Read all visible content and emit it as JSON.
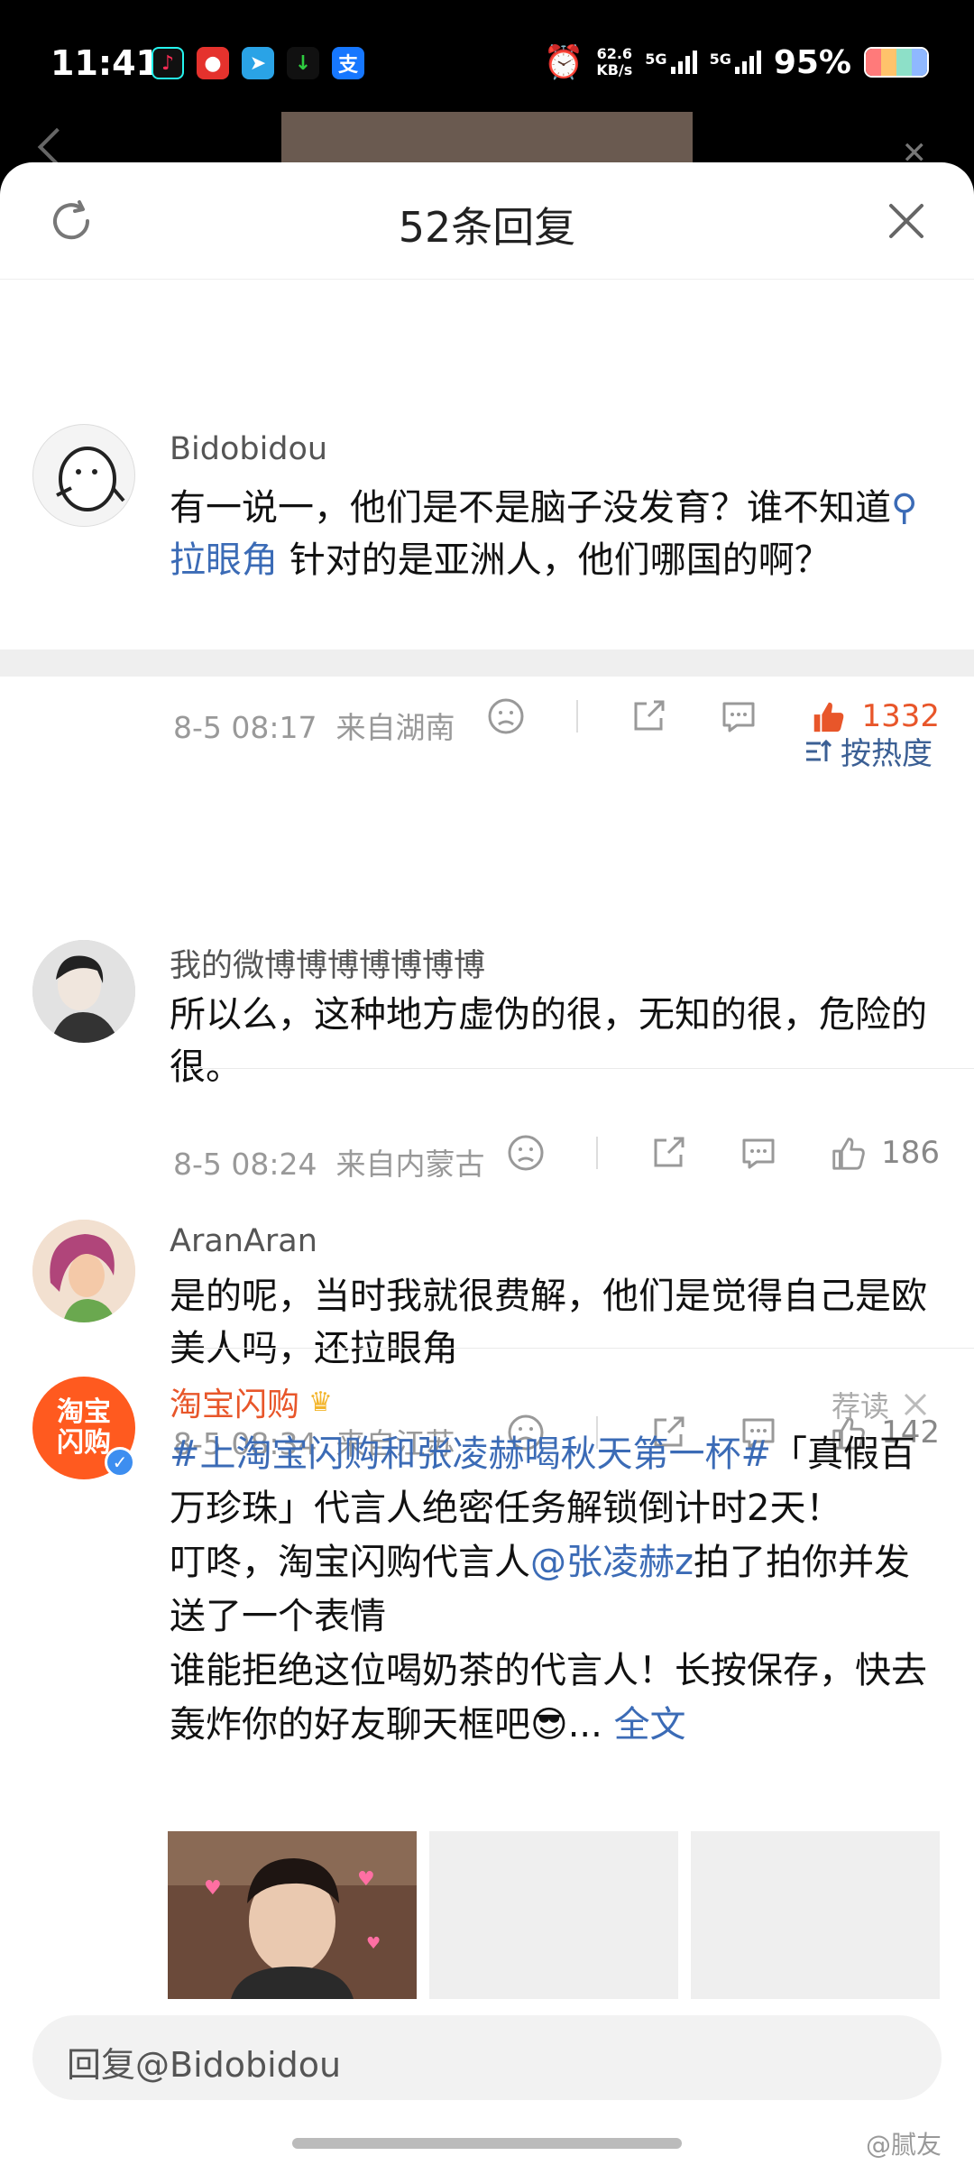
{
  "status": {
    "time": "11:41",
    "speed_top": "62.6",
    "speed_bottom": "KB/s",
    "net1": "5G",
    "net2": "5G",
    "battery": "95%",
    "app_icons": [
      "tiktok-icon",
      "news-icon",
      "telegram-icon",
      "download-icon",
      "alipay-icon"
    ]
  },
  "sheet": {
    "title": "52条回复"
  },
  "main_comment": {
    "user": "Bidobidou",
    "text_before": "有一说一，他们是不是脑子没发育？谁不知道",
    "topic": "拉眼角",
    "text_after": " 针对的是亚洲人，他们哪国的啊？",
    "date": "8-5 08:17",
    "location": "来自湖南",
    "likes": "1332"
  },
  "sort": {
    "label": "按热度"
  },
  "replies": [
    {
      "user": "我的微博博博博博博博",
      "text": "所以么，这种地方虚伪的很，无知的很，危险的很。",
      "date": "8-5 08:24",
      "location": "来自内蒙古",
      "likes": "186"
    },
    {
      "user": "AranAran",
      "text": "是的呢，当时我就很费解，他们是觉得自己是欧美人吗，还拉眼角",
      "date": "8-5 08:34",
      "location": "来自江苏",
      "likes": "142"
    }
  ],
  "ad": {
    "name": "淘宝闪购",
    "avatar_text": "淘宝闪购",
    "tag": "荐读",
    "hashtag": "#上淘宝闪购和张凌赫喝秋天第一杯#",
    "line1_rest": "「真假百万珍珠」代言人绝密任务解锁倒计时2天！",
    "line2_before": "叮咚，淘宝闪购代言人",
    "mention": "@张凌赫z",
    "line2_after": "拍了拍你并发送了一个表情",
    "line3": "谁能拒绝这位喝奶茶的代言人！长按保存，快去轰炸你的好友聊天框吧😎... ",
    "more": "全文"
  },
  "reply_bar": {
    "placeholder": "回复@Bidobidou"
  },
  "watermark": "@腻友",
  "colors": {
    "accent_orange": "#e8562a",
    "link_blue": "#3b6bb6"
  }
}
